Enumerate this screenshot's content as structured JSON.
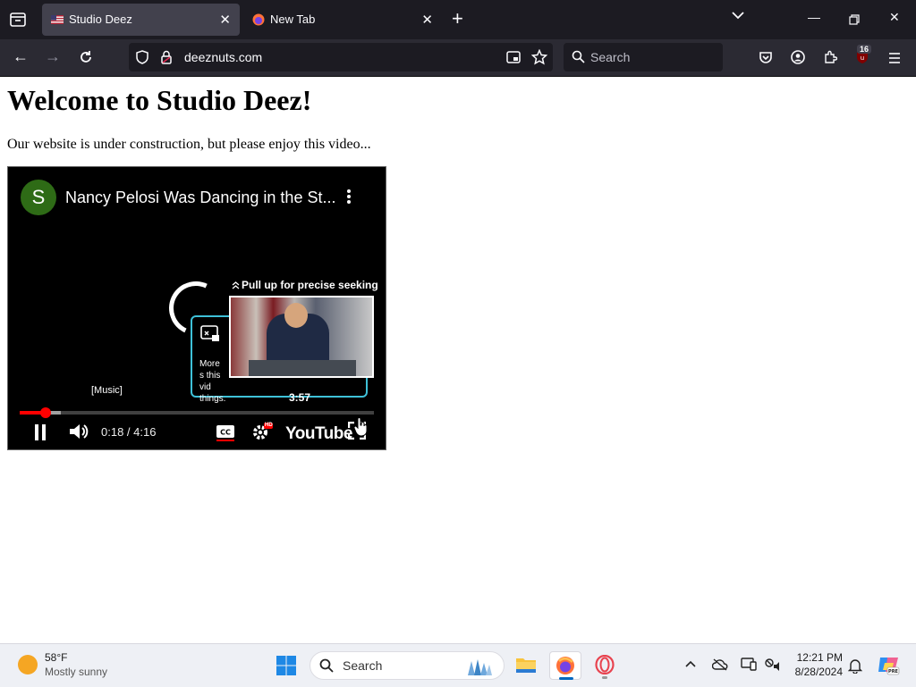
{
  "browser": {
    "tabs": [
      {
        "title": "Studio Deez",
        "active": true
      },
      {
        "title": "New Tab",
        "active": false
      }
    ],
    "url": "deeznuts.com",
    "search_placeholder": "Search",
    "extension_badge": "16"
  },
  "page": {
    "heading": "Welcome to Studio Deez!",
    "intro": "Our website is under construction, but please enjoy this video..."
  },
  "video": {
    "channel_initial": "S",
    "title": "Nancy Pelosi Was Dancing in the St...",
    "seek_hint": "Pull up for precise seeking",
    "card_text": "More s this vid things.",
    "preview_time": "3:57",
    "caption": "[Music]",
    "time_display": "0:18 / 4:16",
    "logo_text": "YouTube",
    "progress": {
      "played_fraction": 0.072,
      "buffered_fraction": 0.115
    },
    "quality_badge": "HD"
  },
  "taskbar": {
    "weather_temp": "58°F",
    "weather_condition": "Mostly sunny",
    "search_placeholder": "Search",
    "time": "12:21 PM",
    "date": "8/28/2024"
  },
  "colors": {
    "tab_bar": "#1c1b22",
    "nav_bar": "#2b2a33",
    "accent_red": "#ff0000",
    "card_border": "#3ec1d8"
  }
}
